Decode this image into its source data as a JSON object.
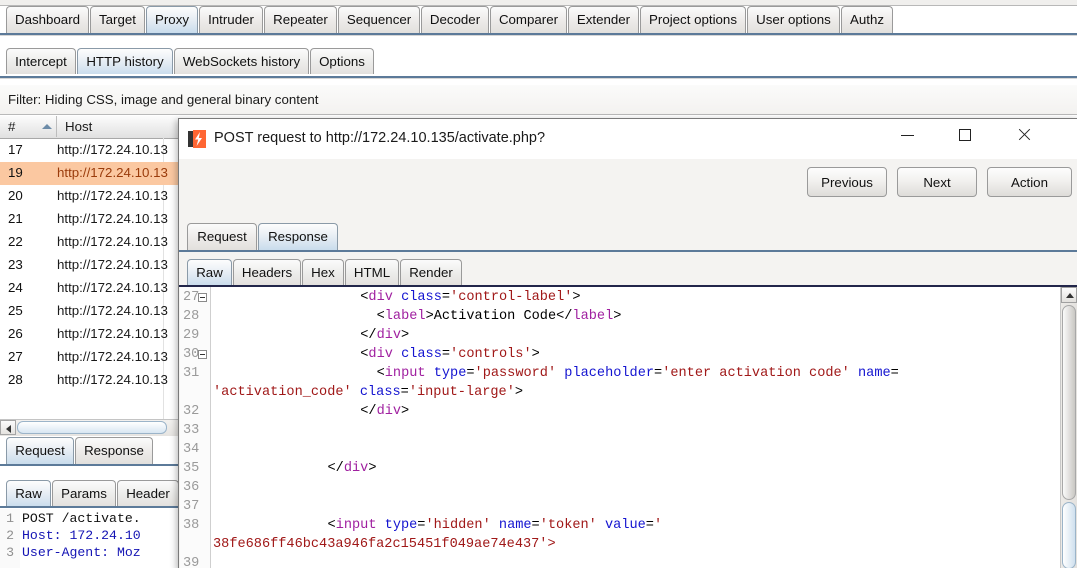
{
  "app": {
    "name": "Burp Suite",
    "accent_selected_tab": "#c9dcec",
    "accent_selected_row": "#fbc8a1",
    "accent_baseline": "#5c7a99"
  },
  "main_tabs": [
    {
      "label": "Dashboard",
      "selected": false
    },
    {
      "label": "Target",
      "selected": false
    },
    {
      "label": "Proxy",
      "selected": true
    },
    {
      "label": "Intruder",
      "selected": false
    },
    {
      "label": "Repeater",
      "selected": false
    },
    {
      "label": "Sequencer",
      "selected": false
    },
    {
      "label": "Decoder",
      "selected": false
    },
    {
      "label": "Comparer",
      "selected": false
    },
    {
      "label": "Extender",
      "selected": false
    },
    {
      "label": "Project options",
      "selected": false
    },
    {
      "label": "User options",
      "selected": false
    },
    {
      "label": "Authz",
      "selected": false
    }
  ],
  "proxy_tabs": [
    {
      "label": "Intercept",
      "selected": false
    },
    {
      "label": "HTTP history",
      "selected": true
    },
    {
      "label": "WebSockets history",
      "selected": false
    },
    {
      "label": "Options",
      "selected": false
    }
  ],
  "filter": {
    "text": "Filter: Hiding CSS, image and general binary content"
  },
  "history_table": {
    "columns": [
      {
        "label": "#",
        "sorted": true,
        "sort_dir": "asc"
      },
      {
        "label": "Host"
      }
    ],
    "rows": [
      {
        "num": "17",
        "host": "http://172.24.10.13",
        "selected": false
      },
      {
        "num": "19",
        "host": "http://172.24.10.13",
        "selected": true
      },
      {
        "num": "20",
        "host": "http://172.24.10.13",
        "selected": false
      },
      {
        "num": "21",
        "host": "http://172.24.10.13",
        "selected": false
      },
      {
        "num": "22",
        "host": "http://172.24.10.13",
        "selected": false
      },
      {
        "num": "23",
        "host": "http://172.24.10.13",
        "selected": false
      },
      {
        "num": "24",
        "host": "http://172.24.10.13",
        "selected": false
      },
      {
        "num": "25",
        "host": "http://172.24.10.13",
        "selected": false
      },
      {
        "num": "26",
        "host": "http://172.24.10.13",
        "selected": false
      },
      {
        "num": "27",
        "host": "http://172.24.10.13",
        "selected": false
      },
      {
        "num": "28",
        "host": "http://172.24.10.13",
        "selected": false
      }
    ]
  },
  "bottom_panel": {
    "tabs": [
      {
        "label": "Request",
        "selected": true
      },
      {
        "label": "Response",
        "selected": false
      }
    ],
    "subtabs": [
      {
        "label": "Raw",
        "selected": true
      },
      {
        "label": "Params",
        "selected": false
      },
      {
        "label": "Header",
        "selected": false
      }
    ],
    "request_lines": [
      {
        "num": "1",
        "text": "POST /activate.",
        "style": "plain"
      },
      {
        "num": "2",
        "text": "Host: 172.24.10",
        "style": "blue"
      },
      {
        "num": "3",
        "text": "User-Agent: Moz",
        "style": "blue"
      }
    ]
  },
  "dialog": {
    "title": "POST request to http://172.24.10.135/activate.php?",
    "icon": "burp-logo-icon",
    "window_buttons": [
      {
        "name": "minimize",
        "glyph": "minimize-icon"
      },
      {
        "name": "maximize",
        "glyph": "maximize-icon"
      },
      {
        "name": "close",
        "glyph": "close-icon"
      }
    ],
    "actions": [
      {
        "label": "Previous"
      },
      {
        "label": "Next"
      },
      {
        "label": "Action"
      }
    ],
    "tabs": [
      {
        "label": "Request",
        "selected": false
      },
      {
        "label": "Response",
        "selected": true
      }
    ],
    "subtabs": [
      {
        "label": "Raw",
        "selected": true
      },
      {
        "label": "Headers",
        "selected": false
      },
      {
        "label": "Hex",
        "selected": false
      },
      {
        "label": "HTML",
        "selected": false
      },
      {
        "label": "Render",
        "selected": false
      }
    ],
    "code_lines": [
      {
        "num": "27",
        "fold": true,
        "indent": 18,
        "tokens": [
          {
            "t": "<",
            "c": "pl"
          },
          {
            "t": "div",
            "c": "tg"
          },
          {
            "t": " ",
            "c": "pl"
          },
          {
            "t": "class",
            "c": "at"
          },
          {
            "t": "=",
            "c": "pl"
          },
          {
            "t": "'control-label'",
            "c": "vl"
          },
          {
            "t": ">",
            "c": "pl"
          }
        ]
      },
      {
        "num": "28",
        "fold": false,
        "indent": 20,
        "tokens": [
          {
            "t": "<",
            "c": "pl"
          },
          {
            "t": "label",
            "c": "tg"
          },
          {
            "t": ">",
            "c": "pl"
          },
          {
            "t": "Activation Code",
            "c": "pl"
          },
          {
            "t": "</",
            "c": "pl"
          },
          {
            "t": "label",
            "c": "tg"
          },
          {
            "t": ">",
            "c": "pl"
          }
        ]
      },
      {
        "num": "29",
        "fold": false,
        "indent": 18,
        "tokens": [
          {
            "t": "</",
            "c": "pl"
          },
          {
            "t": "div",
            "c": "tg"
          },
          {
            "t": ">",
            "c": "pl"
          }
        ]
      },
      {
        "num": "30",
        "fold": true,
        "indent": 18,
        "tokens": [
          {
            "t": "<",
            "c": "pl"
          },
          {
            "t": "div",
            "c": "tg"
          },
          {
            "t": " ",
            "c": "pl"
          },
          {
            "t": "class",
            "c": "at"
          },
          {
            "t": "=",
            "c": "pl"
          },
          {
            "t": "'controls'",
            "c": "vl"
          },
          {
            "t": ">",
            "c": "pl"
          }
        ]
      },
      {
        "num": "31",
        "fold": false,
        "indent": 20,
        "tokens": [
          {
            "t": "<",
            "c": "pl"
          },
          {
            "t": "input",
            "c": "tg"
          },
          {
            "t": " ",
            "c": "pl"
          },
          {
            "t": "type",
            "c": "at"
          },
          {
            "t": "=",
            "c": "pl"
          },
          {
            "t": "'password'",
            "c": "vl"
          },
          {
            "t": " ",
            "c": "pl"
          },
          {
            "t": "placeholder",
            "c": "at"
          },
          {
            "t": "=",
            "c": "pl"
          },
          {
            "t": "'enter activation code'",
            "c": "vl"
          },
          {
            "t": " ",
            "c": "pl"
          },
          {
            "t": "name",
            "c": "at"
          },
          {
            "t": "=",
            "c": "pl"
          }
        ]
      },
      {
        "num": "",
        "fold": false,
        "indent": 0,
        "wrap": true,
        "tokens": [
          {
            "t": "'activation_code'",
            "c": "vl"
          },
          {
            "t": " ",
            "c": "pl"
          },
          {
            "t": "class",
            "c": "at"
          },
          {
            "t": "=",
            "c": "pl"
          },
          {
            "t": "'input-large'",
            "c": "vl"
          },
          {
            "t": ">",
            "c": "pl"
          }
        ]
      },
      {
        "num": "32",
        "fold": false,
        "indent": 18,
        "tokens": [
          {
            "t": "</",
            "c": "pl"
          },
          {
            "t": "div",
            "c": "tg"
          },
          {
            "t": ">",
            "c": "pl"
          }
        ]
      },
      {
        "num": "33",
        "fold": false,
        "indent": 0,
        "tokens": []
      },
      {
        "num": "34",
        "fold": false,
        "indent": 0,
        "tokens": []
      },
      {
        "num": "35",
        "fold": false,
        "indent": 14,
        "tokens": [
          {
            "t": "</",
            "c": "pl"
          },
          {
            "t": "div",
            "c": "tg"
          },
          {
            "t": ">",
            "c": "pl"
          }
        ]
      },
      {
        "num": "36",
        "fold": false,
        "indent": 0,
        "tokens": []
      },
      {
        "num": "37",
        "fold": false,
        "indent": 0,
        "tokens": []
      },
      {
        "num": "38",
        "fold": false,
        "indent": 14,
        "tokens": [
          {
            "t": "<",
            "c": "pl"
          },
          {
            "t": "input",
            "c": "tg"
          },
          {
            "t": " ",
            "c": "pl"
          },
          {
            "t": "type",
            "c": "at"
          },
          {
            "t": "=",
            "c": "pl"
          },
          {
            "t": "'hidden'",
            "c": "vl"
          },
          {
            "t": " ",
            "c": "pl"
          },
          {
            "t": "name",
            "c": "at"
          },
          {
            "t": "=",
            "c": "pl"
          },
          {
            "t": "'token'",
            "c": "vl"
          },
          {
            "t": " ",
            "c": "pl"
          },
          {
            "t": "value",
            "c": "at"
          },
          {
            "t": "=",
            "c": "pl"
          },
          {
            "t": "'",
            "c": "vl"
          }
        ]
      },
      {
        "num": "",
        "fold": false,
        "indent": 0,
        "wrap": true,
        "tokens": [
          {
            "t": "38fe686ff46bc43a946fa2c15451f049ae74e437'>",
            "c": "vl"
          }
        ]
      },
      {
        "num": "39",
        "fold": false,
        "indent": 0,
        "tokens": []
      }
    ],
    "token_value": "38fe686ff46bc43a946fa2c15451f049ae74e437"
  }
}
